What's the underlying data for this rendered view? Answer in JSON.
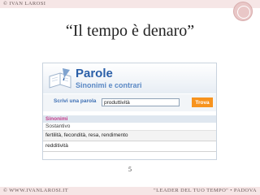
{
  "header_band": {
    "copyright": "© IVAN LAROSI"
  },
  "slide": {
    "title": "“Il tempo è denaro”",
    "page_number": "5"
  },
  "app": {
    "title": "Parole",
    "subtitle": "Sinonimi e contrari",
    "search": {
      "label": "Scrivi una parola",
      "value": "produttività",
      "button_label": "Trova"
    },
    "results": {
      "heading": "Sinonimi",
      "part_of_speech": "Sostantivo",
      "rows": [
        "fertilità, fecondità, resa, rendimento",
        "redditività"
      ]
    }
  },
  "footer_band": {
    "left": "© WWW.IVANLAROSI.IT",
    "right": "\"LEADER DEL TUO TEMPO\" • PADOVA"
  },
  "colors": {
    "band": "#f6e6e6",
    "brand_blue": "#2a5fa8",
    "button_orange": "#f7931e",
    "heading_magenta": "#c43b8a"
  }
}
